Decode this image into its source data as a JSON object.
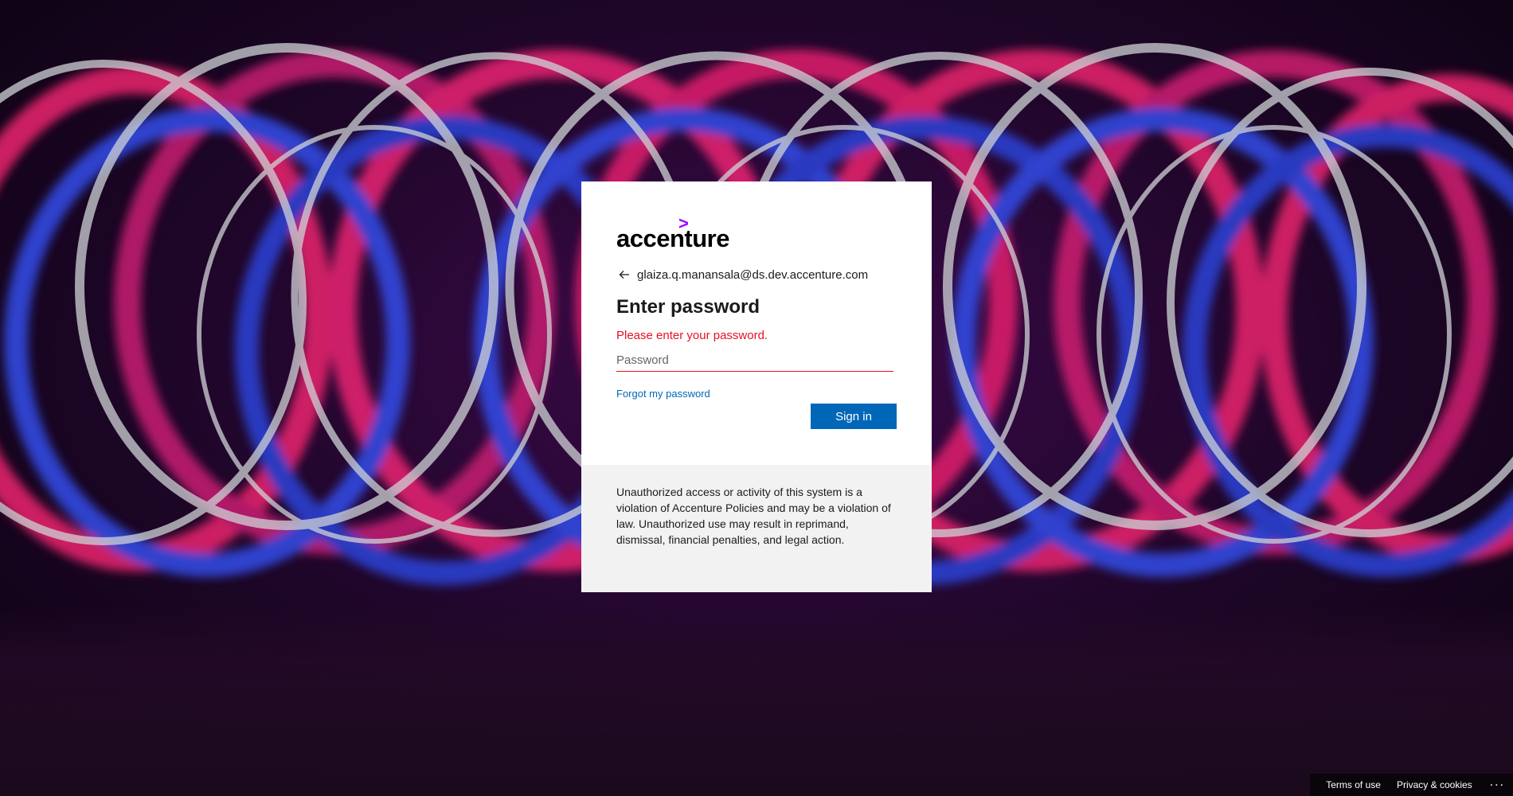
{
  "brand": {
    "logo_text": "accenture",
    "accent_color": "#a100ff"
  },
  "identity": {
    "email": "glaiza.q.manansala@ds.dev.accenture.com",
    "back_icon": "back-arrow-icon"
  },
  "form": {
    "title": "Enter password",
    "error": "Please enter your password.",
    "password_placeholder": "Password",
    "password_value": "",
    "forgot_link": "Forgot my password",
    "submit_label": "Sign in",
    "primary_color": "#0067b8",
    "error_color": "#e81123"
  },
  "notice": {
    "text": "Unauthorized access or activity of this system is a violation of Accenture Policies and may be a violation of law. Unauthorized use may result in reprimand, dismissal, financial penalties, and legal action."
  },
  "footer": {
    "terms": "Terms of use",
    "privacy": "Privacy & cookies",
    "more": "..."
  }
}
